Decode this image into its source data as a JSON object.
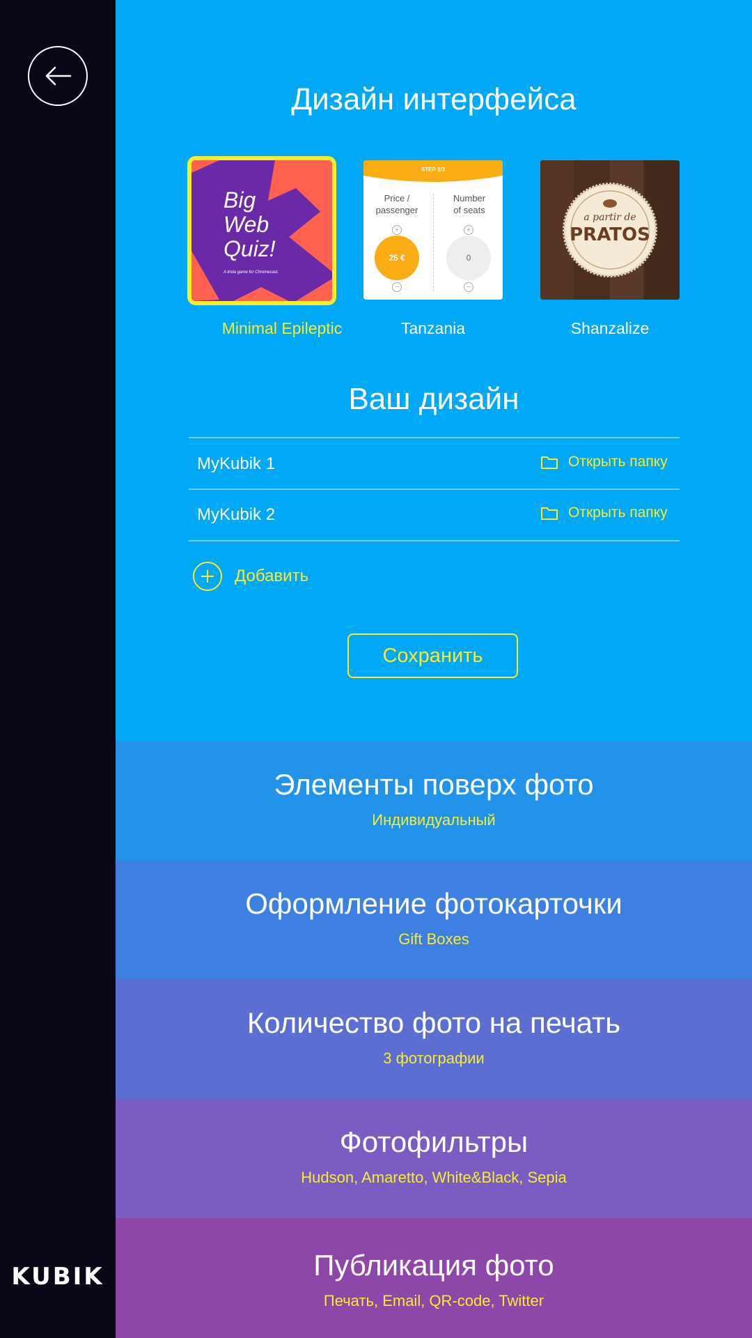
{
  "app": {
    "logo": "KUBIK"
  },
  "design": {
    "title": "Дизайн интерфейса",
    "thumbnails": [
      {
        "name": "Minimal Epileptic",
        "selected": true,
        "preview": {
          "line1": "Big",
          "line2": "Web",
          "line3": "Quiz!",
          "caption": "A trivia game for Chromecast."
        }
      },
      {
        "name": "Tanzania",
        "selected": false,
        "preview": {
          "step": "STEP 3/3",
          "col1_l1": "Price /",
          "col1_l2": "passenger",
          "col2_l1": "Number",
          "col2_l2": "of seats",
          "price": "25 €",
          "seats": "0"
        }
      },
      {
        "name": "Shanzalize",
        "selected": false,
        "preview": {
          "line1": "a partir de",
          "line2": "PRATOS"
        }
      }
    ]
  },
  "your_design": {
    "title": "Ваш дизайн",
    "items": [
      {
        "name": "MyKubik 1",
        "open_label": "Открыть папку"
      },
      {
        "name": "MyKubik 2",
        "open_label": "Открыть папку"
      }
    ],
    "add_label": "Добавить",
    "save_label": "Сохранить"
  },
  "sections": [
    {
      "title": "Элементы поверх фото",
      "subtitle": "Индивидуальный",
      "color": "#2393ea"
    },
    {
      "title": "Оформление фотокарточки",
      "subtitle": "Gift Boxes",
      "color": "#3d80e1"
    },
    {
      "title": "Количество фото на печать",
      "subtitle": "3 фотографии",
      "color": "#5d6ed2"
    },
    {
      "title": "Фотофильтры",
      "subtitle": "Hudson, Amaretto, White&Black, Sepia",
      "color": "#7b5cc2"
    },
    {
      "title": "Публикация фото",
      "subtitle": "Печать, Email, QR-code, Twitter",
      "color": "#8d47a9"
    }
  ],
  "colors": {
    "accent": "#f8ed2a",
    "background": "#00a8f6",
    "sidebar": "#0b0716"
  }
}
